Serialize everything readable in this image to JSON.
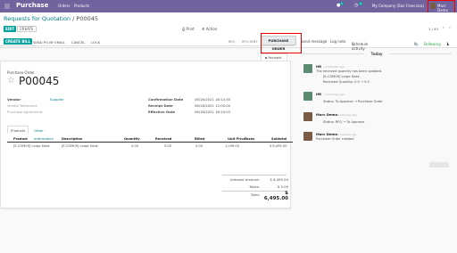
{
  "navbar": {
    "app_name": "Purchase",
    "menu": [
      "Orders",
      "Products"
    ],
    "chat_count": "5",
    "activity_count": "9",
    "company": "My Company (San Francisco)",
    "user": "Marc Demo"
  },
  "breadcrumb": {
    "parent": "Requests for Quotation",
    "separator": "/",
    "current": "P00045"
  },
  "control": {
    "edit_label": "EDIT",
    "create_label": "CREATE",
    "print_label": "Print",
    "action_label": "Action",
    "pager": "1 / 43"
  },
  "statusbar": {
    "create_bill": "CREATE BILL",
    "send_po": "SEND PO BY EMAIL",
    "cancel": "CANCEL",
    "lock": "LOCK",
    "stages": [
      "RFQ",
      "RFQ SENT"
    ],
    "active_stage": "PURCHASE ORDER",
    "receipt_label": "Receipts"
  },
  "chatter_bar": {
    "send_message": "Send message",
    "log_note": "Log note",
    "schedule": "Schedule activity",
    "attachments": "0",
    "following": "Following",
    "followers": "1"
  },
  "form": {
    "doc_type": "Purchase Order",
    "name": "P00045",
    "vendor_label": "Vendor",
    "vendor_value": "Supplier",
    "vendor_ref_label": "Vendor Reference",
    "agreement_label": "Purchase Agreement",
    "confirmation_label": "Confirmation Date",
    "confirmation_value": "08/16/2021 16:14:30",
    "receipt_date_label": "Receipt Date",
    "receipt_date_value": "08/16/2021 12:00:00",
    "effective_label": "Effective Date",
    "effective_value": "08/16/2021 16:15:03",
    "tabs": [
      "Products",
      "Other Information"
    ],
    "columns": [
      "Product",
      "Description",
      "Quantity",
      "Received",
      "Billed",
      "Unit Price",
      "Taxes",
      "Subtotal"
    ],
    "rows": [
      {
        "product": "[E-COM09] Large Desk",
        "description": "[E-COM09] Large Desk",
        "quantity": "5.00",
        "received": "5.00",
        "billed": "0.00",
        "unit_price": "1,299.00",
        "taxes": "",
        "subtotal": "$ 6,495.00"
      }
    ],
    "untaxed_label": "Untaxed Amount:",
    "untaxed_value": "$ 6,495.00",
    "taxes_label": "Taxes:",
    "taxes_value": "$ 0.00",
    "total_label": "Total:",
    "total_value": "$ 6,495.00"
  },
  "chatter": {
    "today": "Today",
    "messages": [
      {
        "author": "HR",
        "time": "- 4 minutes ago",
        "lines": [
          "The received quantity has been updated.",
          "[E-COM09] Large Desk",
          "Received Quantity: 0.0 → 5.0"
        ]
      },
      {
        "author": "HR",
        "time": "- 4 minutes ago",
        "lines": [
          "Status: To Approve → Purchase Order"
        ]
      },
      {
        "author": "Marc Demo",
        "time": "- 4 minutes ago",
        "lines": [
          "Status: RFQ → To Approve"
        ]
      },
      {
        "author": "Marc Demo",
        "time": "- 4 minutes ago",
        "lines": [
          "Purchase Order created"
        ]
      }
    ]
  },
  "colors": {
    "navbar": "#71639e",
    "primary": "#00a09d",
    "link": "#017e84",
    "highlight": "#ee0000"
  }
}
